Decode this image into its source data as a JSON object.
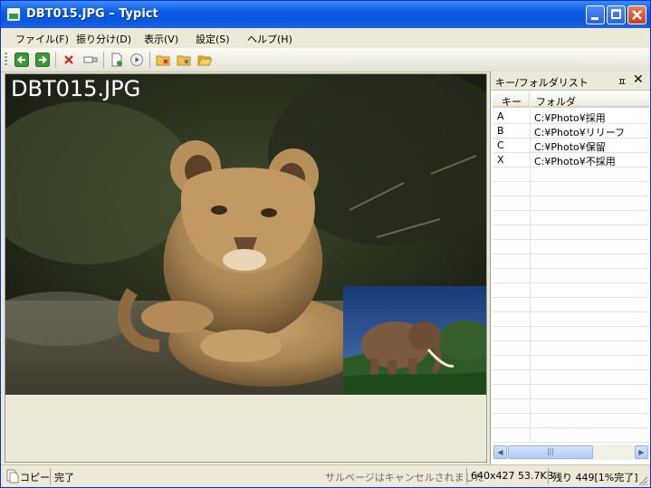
{
  "window": {
    "title": "DBT015.JPG – Typict"
  },
  "menu": [
    "ファイル(F)",
    "振り分け(D)",
    "表示(V)",
    "設定(S)",
    "ヘルプ(H)"
  ],
  "viewer": {
    "filename": "DBT015.JPG"
  },
  "panel": {
    "title": "キー/フォルダリスト",
    "pin": "ㅍ",
    "close": "✕",
    "columns": [
      "キー",
      "フォルダ"
    ],
    "rows": [
      {
        "key": "A",
        "folder": "C:¥Photo¥採用"
      },
      {
        "key": "B",
        "folder": "C:¥Photo¥リリーフ"
      },
      {
        "key": "C",
        "folder": "C:¥Photo¥保留"
      },
      {
        "key": "X",
        "folder": "C:¥Photo¥不採用"
      }
    ],
    "scroll_left": "◀",
    "scroll_right": "▶",
    "scroll_thumb": "|||"
  },
  "status": {
    "mode": "コピー",
    "state": "完了",
    "message": "サルベージはキャンセルされました",
    "image_info": "640x427 53.7KB",
    "remaining": "残り 449[1%完了]"
  },
  "colors": {
    "title_bar": "#0b5ce5",
    "accent": "#316ac5"
  }
}
